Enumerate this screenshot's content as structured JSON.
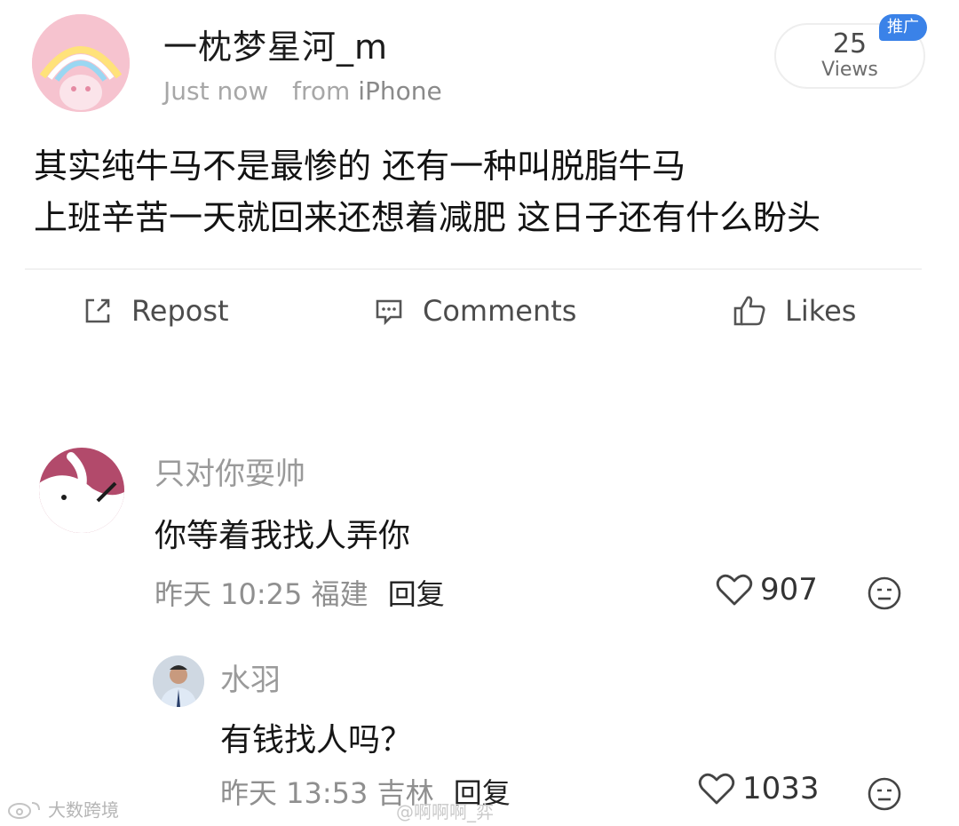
{
  "post": {
    "username": "一枕梦星河_m",
    "time": "Just now",
    "from_label": "from",
    "device": "iPhone",
    "views_count": "25",
    "views_label": "Views",
    "ad_badge": "推广",
    "text_lines": [
      "其实纯牛马不是最惨的 还有一种叫脱脂牛马",
      "上班辛苦一天就回来还想着减肥 这日子还有什么盼头"
    ],
    "actions": {
      "repost": "Repost",
      "comments": "Comments",
      "likes": "Likes"
    }
  },
  "comments": [
    {
      "name": "只对你耍帅",
      "text": "你等着我找人弄你",
      "meta": "昨天 10:25 福建",
      "reply_label": "回复",
      "likes": "907"
    },
    {
      "name": "水羽",
      "text": "有钱找人吗？",
      "meta": "昨天 13:53 吉林",
      "reply_label": "回复",
      "likes": "1033"
    }
  ],
  "watermark": "大数跨境",
  "watermark2": "@啊啊啊_弈",
  "colors": {
    "ad_badge_bg": "#3a82e8",
    "meta_gray": "#a7a7a7"
  }
}
